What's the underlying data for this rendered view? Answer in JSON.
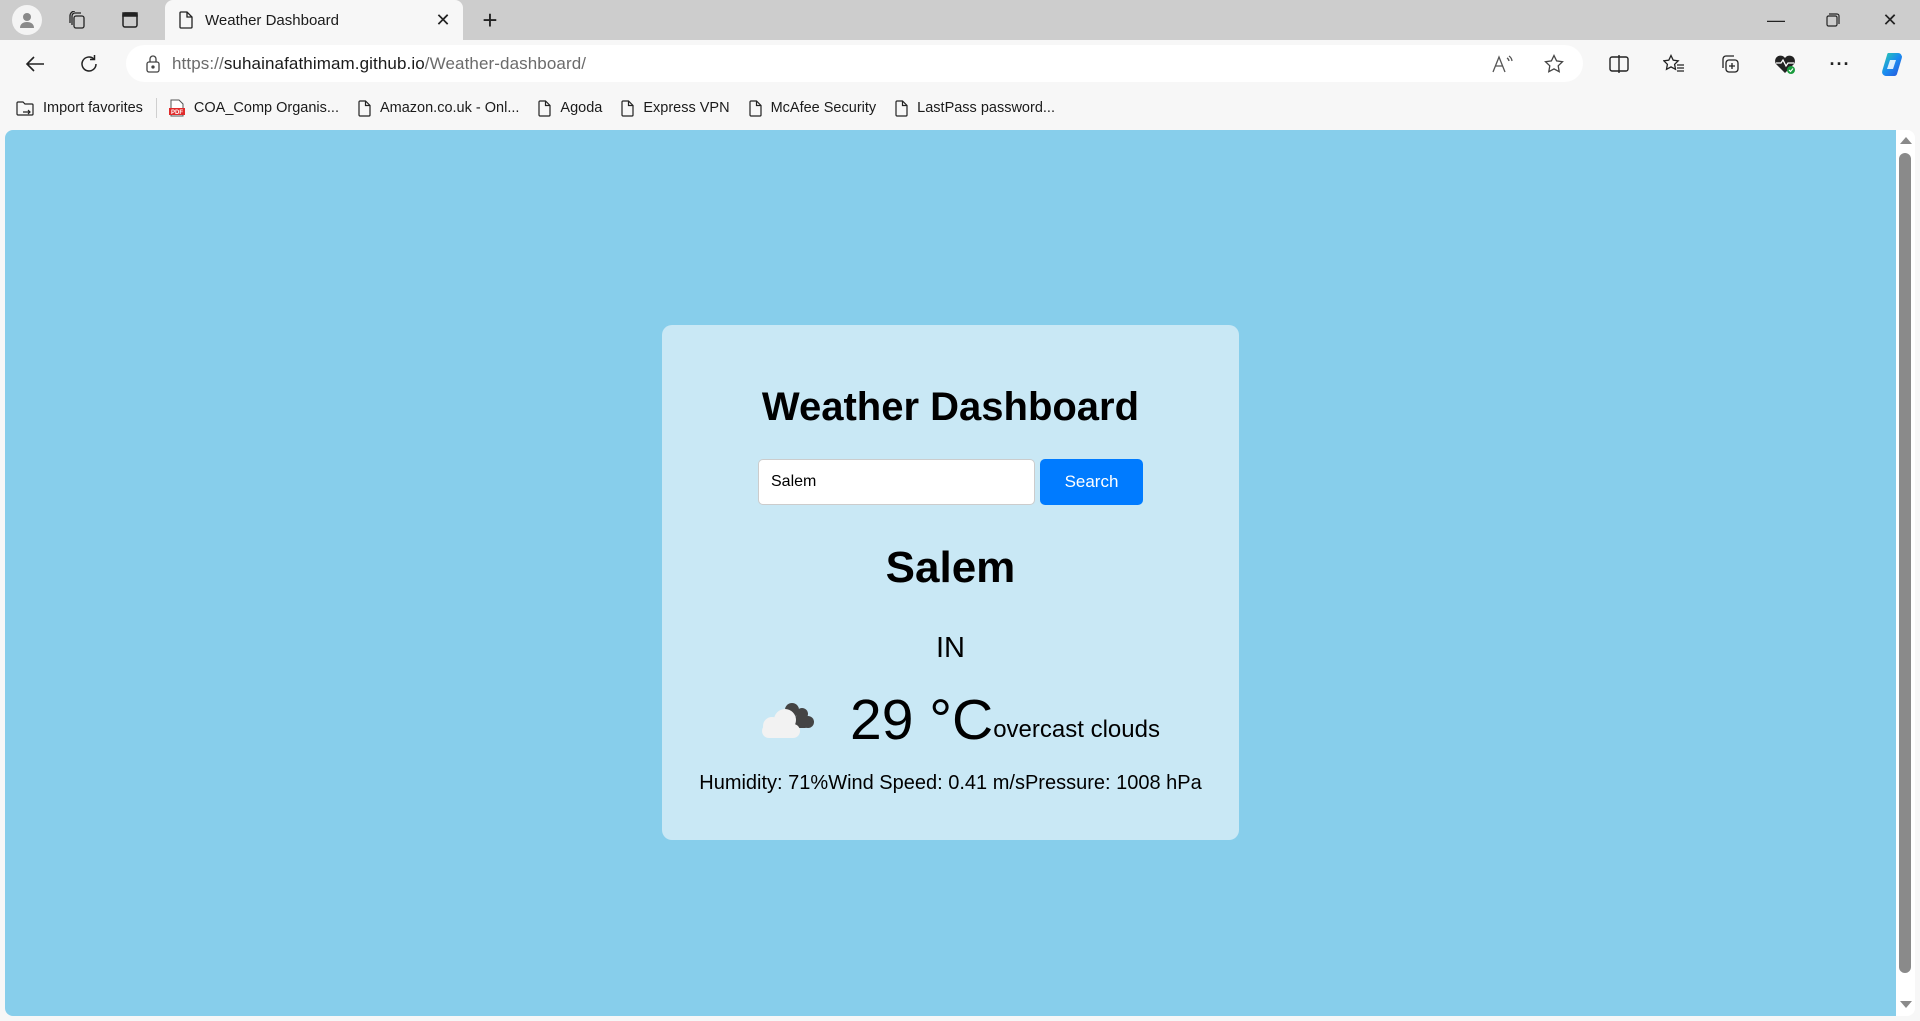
{
  "browser": {
    "tab": {
      "title": "Weather Dashboard",
      "icon": "page-icon"
    },
    "address": {
      "scheme": "https://",
      "host": "suhainafathimam.github.io",
      "path": "/Weather-dashboard/"
    },
    "toolbar_icons": [
      "read-aloud-icon",
      "favorite-star-icon",
      "split-screen-icon",
      "favorites-icon",
      "collections-icon",
      "browser-essentials-icon",
      "more-icon",
      "copilot-icon"
    ],
    "bookmarks": [
      {
        "label": "Import favorites",
        "icon": "import-icon"
      },
      {
        "label": "COA_Comp Organis...",
        "icon": "pdf-icon"
      },
      {
        "label": "Amazon.co.uk - Onl...",
        "icon": "page-icon"
      },
      {
        "label": "Agoda",
        "icon": "page-icon"
      },
      {
        "label": "Express VPN",
        "icon": "page-icon"
      },
      {
        "label": "McAfee Security",
        "icon": "page-icon"
      },
      {
        "label": "LastPass password...",
        "icon": "page-icon"
      }
    ]
  },
  "page": {
    "title": "Weather Dashboard",
    "search": {
      "value": "Salem",
      "button_label": "Search"
    },
    "weather": {
      "city": "Salem",
      "country": "IN",
      "icon": "overcast-clouds-icon",
      "temperature": "29 °C",
      "description": "overcast clouds",
      "humidity": "Humidity: 71%",
      "wind_speed": "Wind Speed: 0.41 m/s",
      "pressure": "Pressure: 1008 hPa"
    },
    "colors": {
      "background": "#87ceeb",
      "card": "#c9e8f5",
      "button": "#007bff"
    }
  }
}
